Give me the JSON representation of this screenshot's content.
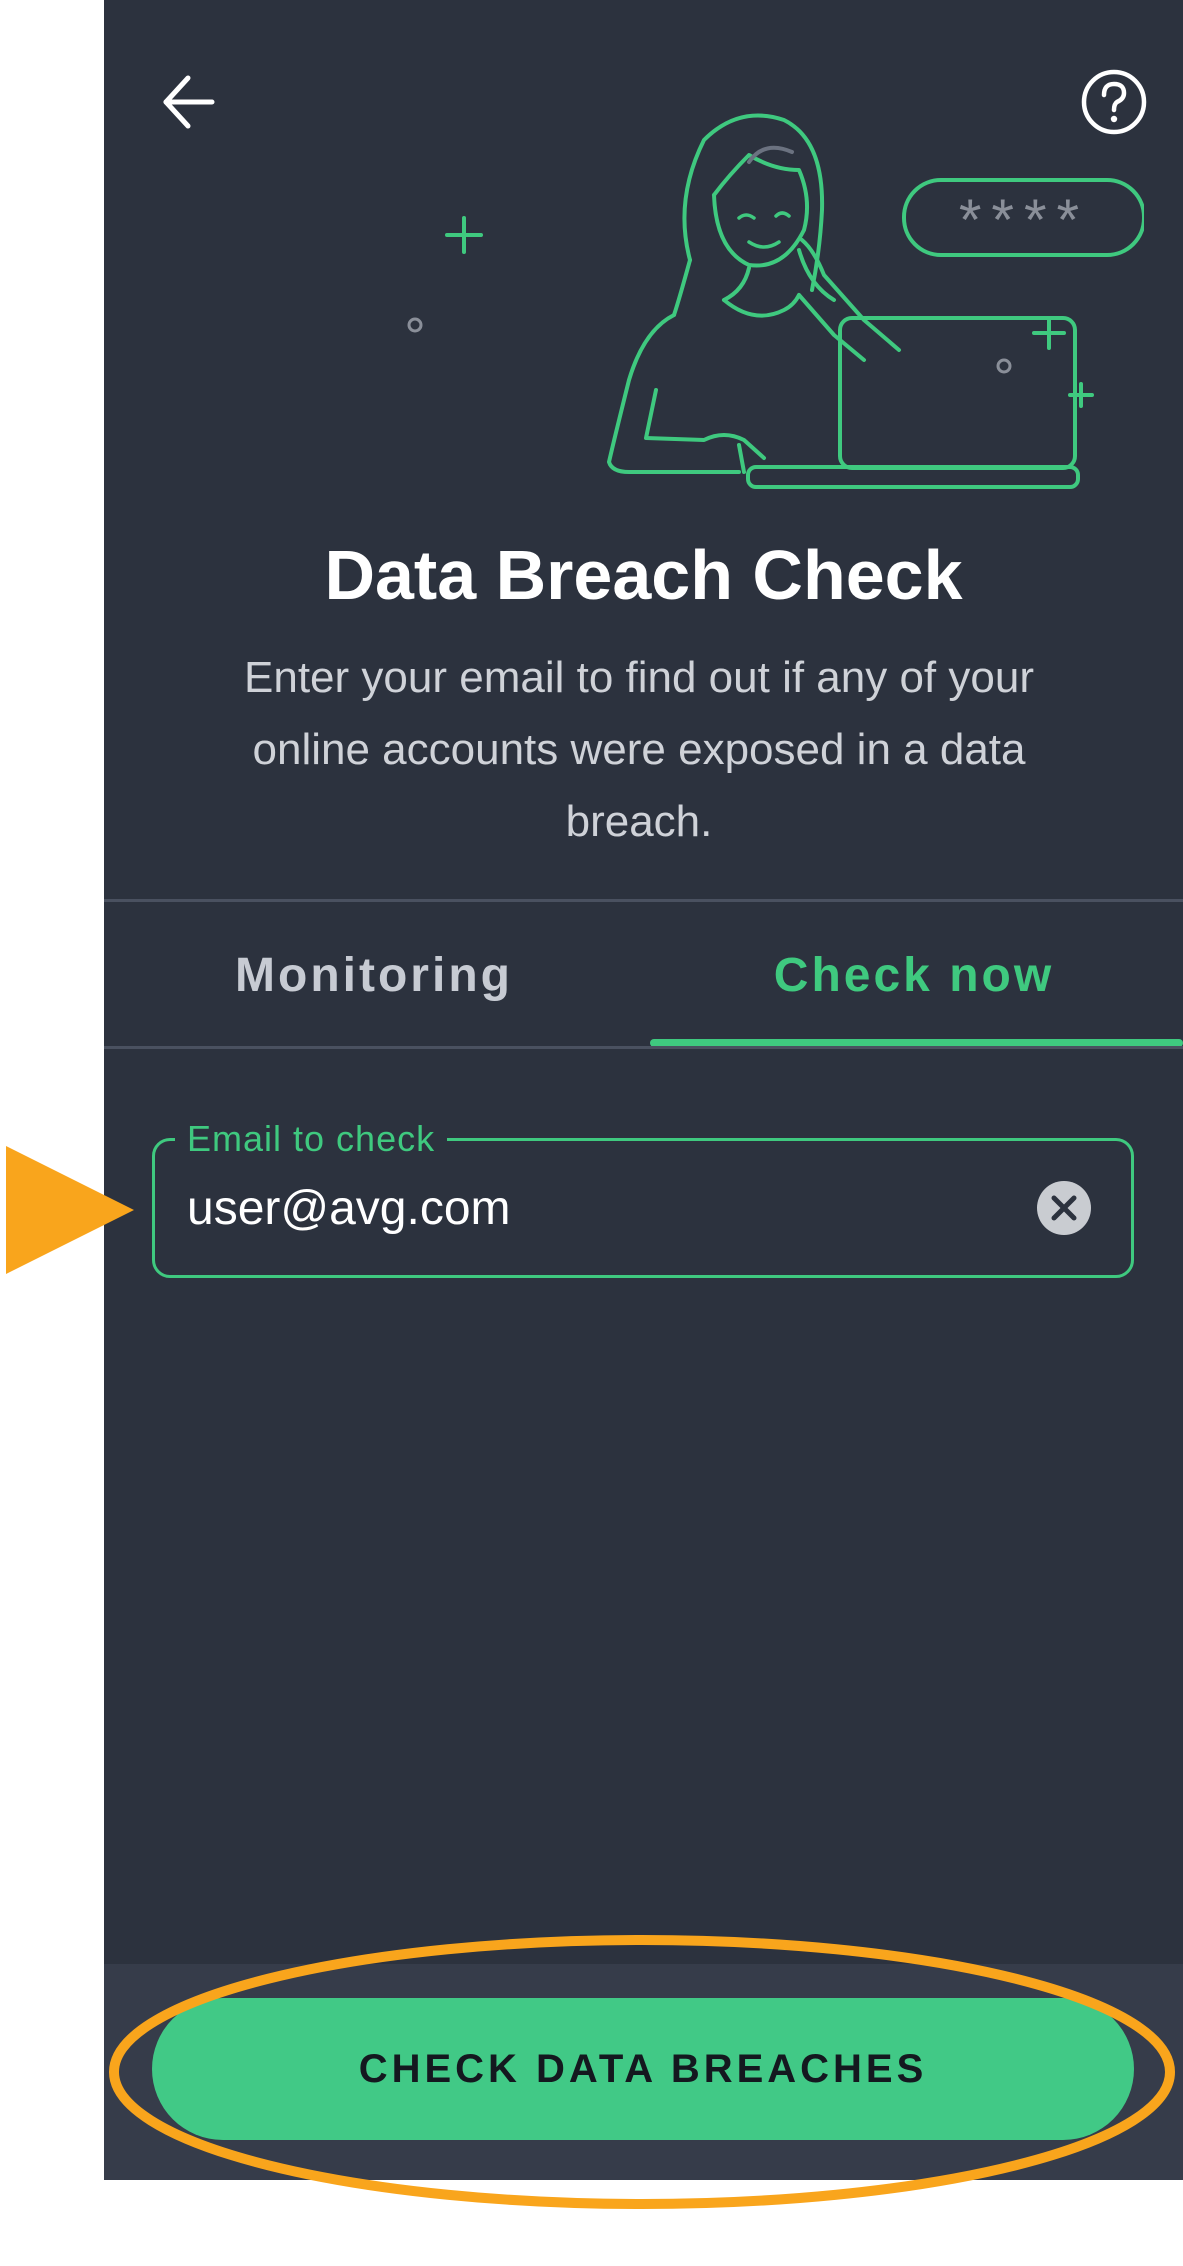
{
  "header": {
    "back_icon": "arrow-left-icon",
    "help_icon": "question-circle-icon"
  },
  "hero": {
    "illustration": "woman-with-laptop-illustration",
    "password_mask": "****"
  },
  "title": "Data Breach Check",
  "subtitle": "Enter your email to find out if any of your online accounts were exposed in a data breach.",
  "tabs": [
    {
      "label": "Monitoring",
      "active": false
    },
    {
      "label": "Check now",
      "active": true
    }
  ],
  "email_field": {
    "label": "Email to check",
    "value": "user@avg.com",
    "clear_icon": "clear-x-icon"
  },
  "cta": {
    "label": "CHECK DATA BREACHES"
  },
  "annotations": {
    "pointer_color": "#f9a51c",
    "ellipse_color": "#f9a51c"
  },
  "colors": {
    "background": "#2c323e",
    "accent": "#3fc97f",
    "button": "#41c986",
    "text": "#ffffff"
  }
}
